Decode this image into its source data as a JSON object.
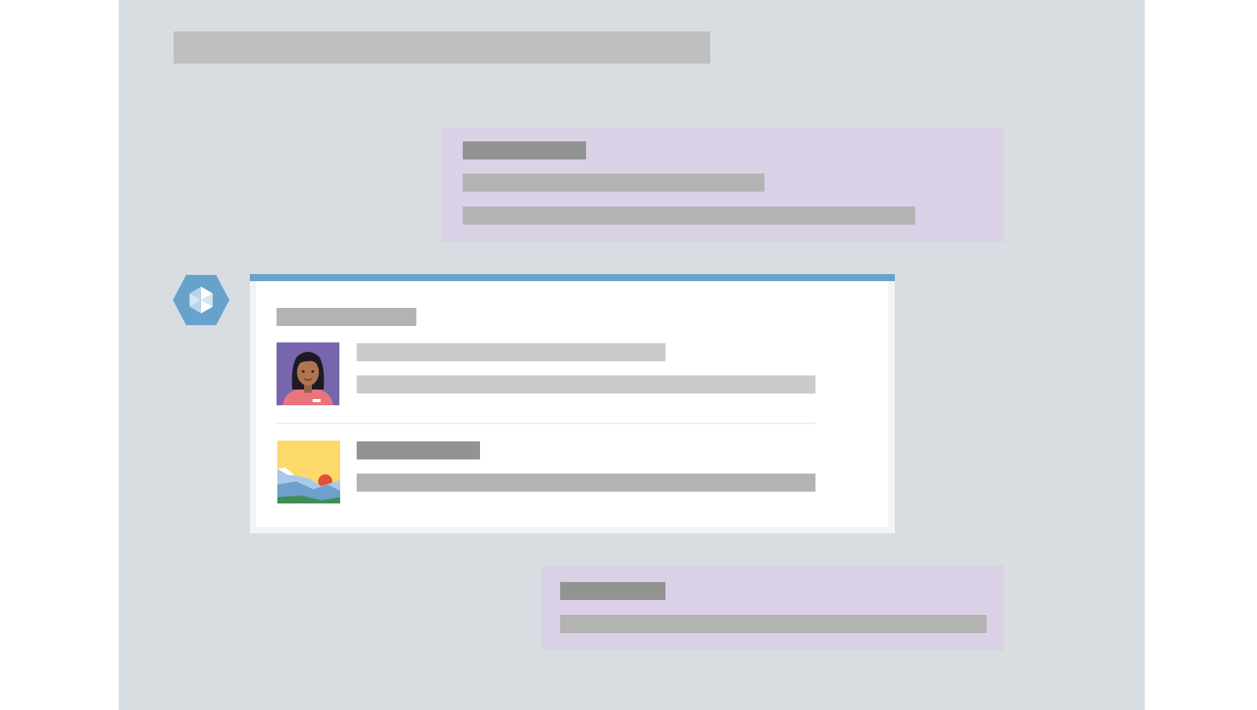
{
  "page": {
    "canvas_color": "#d8dde1",
    "outer_color": "#ffffff",
    "header_placeholder_color": "#bebfc1"
  },
  "messages": [
    {
      "type": "user-bubble",
      "background": "#dbd1e6",
      "placeholder_lines": [
        "dark",
        "medium",
        "medium"
      ]
    },
    {
      "type": "bot-card",
      "accent_color": "#67a2cb",
      "avatar_icon": "hexagon-bot-icon",
      "items": [
        {
          "thumbnail": "person-portrait-icon",
          "placeholder_lines": [
            "light",
            "light"
          ]
        },
        {
          "thumbnail": "landscape-image-icon",
          "placeholder_lines": [
            "dark",
            "medium"
          ]
        }
      ]
    },
    {
      "type": "user-bubble",
      "background": "#dbd1e6",
      "placeholder_lines": [
        "dark",
        "medium"
      ]
    }
  ],
  "placeholder_colors": {
    "dark": "#939393",
    "medium": "#b3b3b3",
    "light": "#cbcbca"
  }
}
